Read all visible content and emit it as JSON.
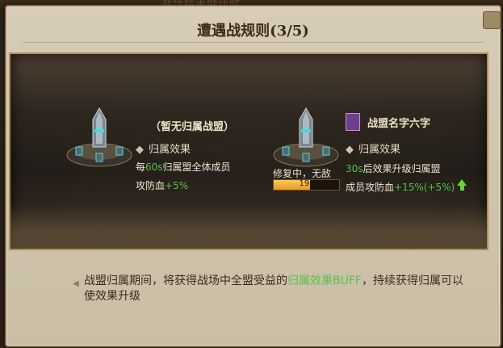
{
  "background_text": "战场结束倒计时",
  "dialog": {
    "title": "遭遇战规则(3/5)"
  },
  "left_panel": {
    "alliance_name": "（暂无归属战盟）",
    "effect_title": "归属效果",
    "line1_a": "每",
    "line1_b": "60s",
    "line1_c": "归属盟全体成员",
    "line2_a": "攻防血",
    "line2_b": "+5%"
  },
  "right_panel": {
    "alliance_name": "战盟名字六字",
    "effect_title": "归属效果",
    "repair_text": "修复中，无敌",
    "timer": "19s",
    "progress_fraction": 0.55,
    "line1_a": "30s",
    "line1_b": "后效果升级归属盟",
    "line2_a": "成员攻防血",
    "line2_b": "+15%",
    "line2_c": "(+5%)"
  },
  "note": {
    "part1": "战盟归属期间，将获得战场中全盟受益的",
    "part2": "归属效果BUFF",
    "part3": "，持续获得归属可以使效果升级"
  },
  "icons": [
    "tower-icon",
    "alliance-flag-icon",
    "upgrade-arrow-icon",
    "close-icon",
    "bullet-diamond-icon"
  ]
}
